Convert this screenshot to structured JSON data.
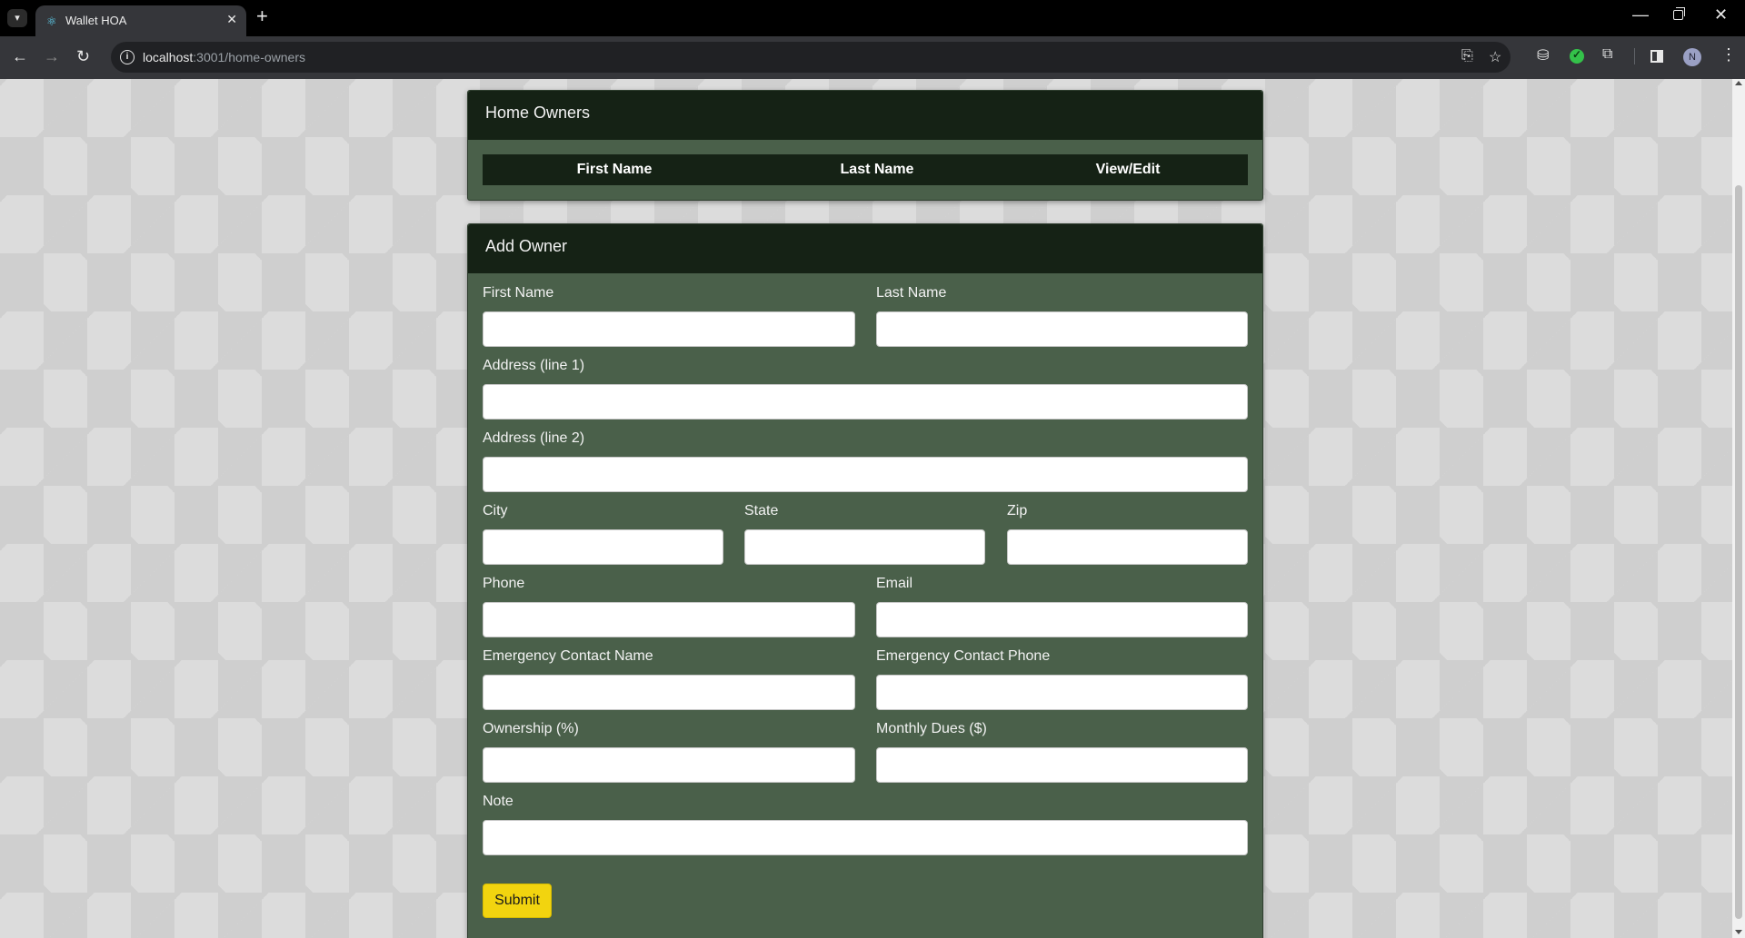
{
  "browser": {
    "tab_title": "Wallet HOA",
    "url_host": "localhost",
    "url_rest": ":3001/home-owners",
    "avatar_letter": "N"
  },
  "owners_card": {
    "title": "Home Owners",
    "columns": [
      "First Name",
      "Last Name",
      "View/Edit"
    ]
  },
  "add_owner": {
    "title": "Add Owner",
    "fields": {
      "first_name": "First Name",
      "last_name": "Last Name",
      "address_line1": "Address (line 1)",
      "address_line2": "Address (line 2)",
      "city": "City",
      "state": "State",
      "zip": "Zip",
      "phone": "Phone",
      "email": "Email",
      "emergency_name": "Emergency Contact Name",
      "emergency_phone": "Emergency Contact Phone",
      "ownership": "Ownership (%)",
      "monthly_dues": "Monthly Dues ($)",
      "note": "Note"
    },
    "submit_label": "Submit"
  },
  "colors": {
    "card_body": "#4a604a",
    "card_header": "#152215",
    "submit": "#f2d40f"
  }
}
